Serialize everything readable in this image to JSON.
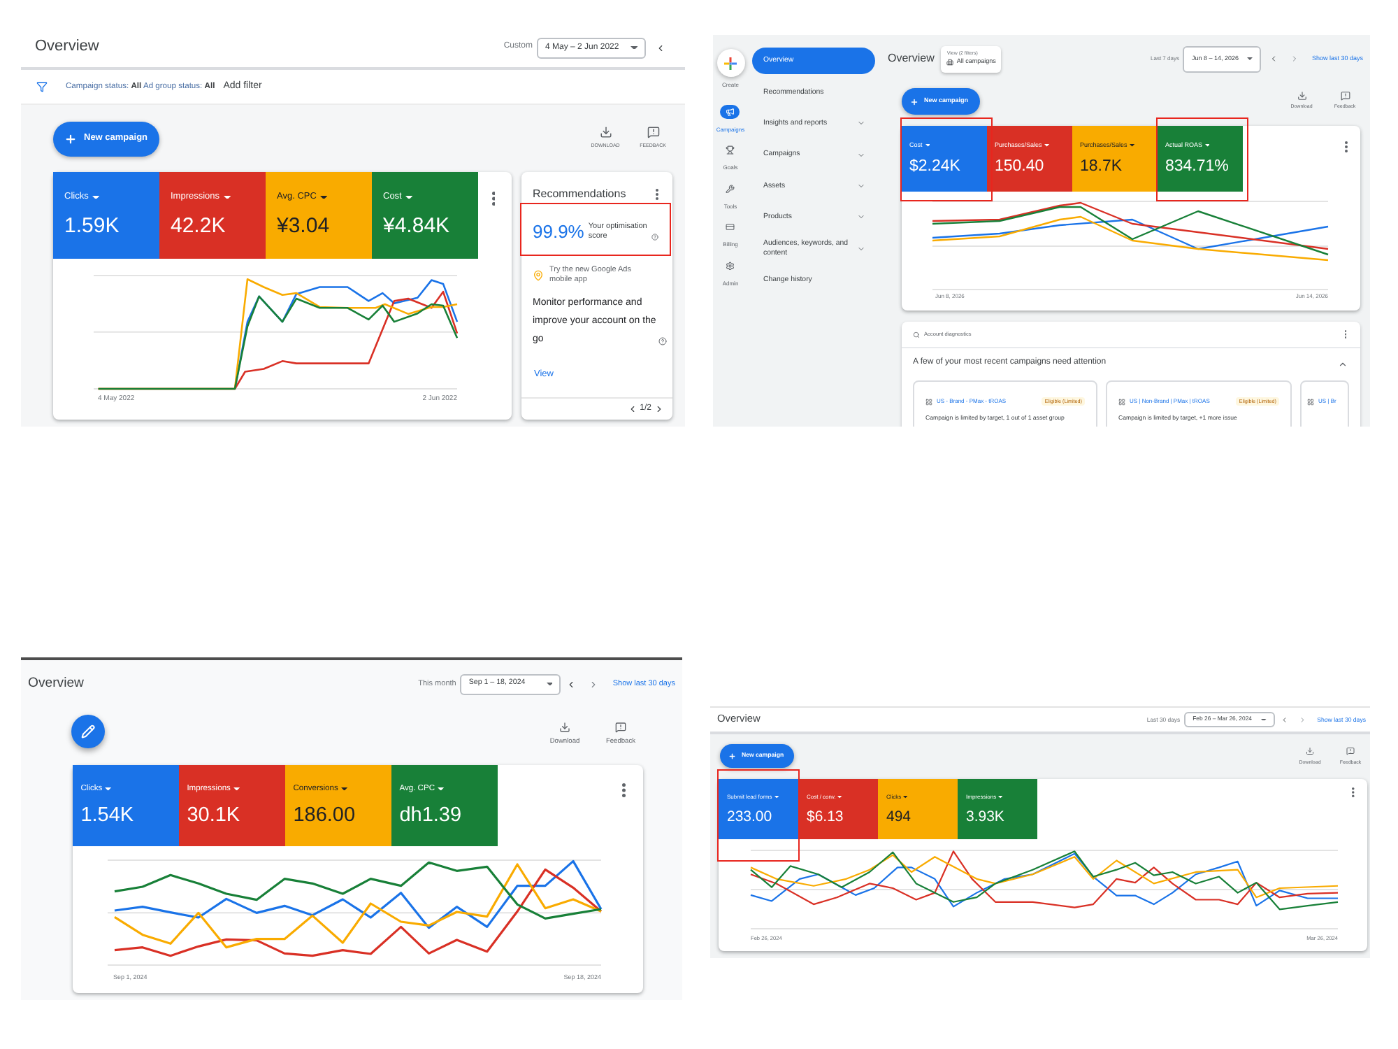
{
  "screenshots": [
    {
      "header": {
        "title": "Overview",
        "date_range_label": "Custom",
        "date_range": "4 May – 2 Jun 2022"
      },
      "filter_bar": {
        "filters": "Campaign status: **All** Ad group status: **All**",
        "add_filter": "Add filter"
      },
      "primary_action": {
        "kind": "new_campaign",
        "label": "New campaign"
      },
      "actions": [
        {
          "kind": "download",
          "label": "DOWNLOAD"
        },
        {
          "kind": "feedback",
          "label": "FEEDBACK"
        }
      ],
      "metrics": [
        {
          "label": "Clicks",
          "value": "1.59K",
          "color": "#1a73e8",
          "highlighted": false
        },
        {
          "label": "Impressions",
          "value": "42.2K",
          "color": "#d93025",
          "highlighted": false
        },
        {
          "label": "Avg. CPC",
          "value": "¥3.04",
          "color": "#f9ab00",
          "highlighted": false
        },
        {
          "label": "Cost",
          "value": "¥4.84K",
          "color": "#188038",
          "highlighted": false
        }
      ],
      "chart": {
        "start_date": "4 May 2022",
        "end_date": "2 Jun 2022"
      },
      "recommendations": {
        "title": "Recommendations",
        "score": "99.9%",
        "score_label": "Your optimisation score",
        "highlighted": true,
        "promo": "Try the new Google Ads mobile app",
        "message": "Monitor performance and improve your account on the go",
        "link": "View",
        "pager": "1/2"
      }
    },
    {
      "navigation_rail": [
        {
          "kind": "create",
          "label": "Create",
          "selected": false
        },
        {
          "kind": "campaigns",
          "label": "Campaigns",
          "selected": true
        },
        {
          "kind": "goals",
          "label": "Goals",
          "selected": false
        },
        {
          "kind": "tools",
          "label": "Tools",
          "selected": false
        },
        {
          "kind": "billing",
          "label": "Billing",
          "selected": false
        },
        {
          "kind": "admin",
          "label": "Admin",
          "selected": false
        }
      ],
      "sidebar": [
        {
          "label": "Overview",
          "selected": true,
          "expandable": false
        },
        {
          "label": "Recommendations",
          "selected": false,
          "expandable": false
        },
        {
          "label": "Insights and reports",
          "selected": false,
          "expandable": true
        },
        {
          "label": "Campaigns",
          "selected": false,
          "expandable": true
        },
        {
          "label": "Assets",
          "selected": false,
          "expandable": true
        },
        {
          "label": "Products",
          "selected": false,
          "expandable": true
        },
        {
          "label": "Audiences, keywords, and content",
          "selected": false,
          "expandable": true
        },
        {
          "label": "Change history",
          "selected": false,
          "expandable": false
        }
      ],
      "header": {
        "title": "Overview",
        "view_filter": {
          "label": "View (2 filters)",
          "value": "All campaigns"
        },
        "date_range_label": "Last 7 days",
        "date_range": "Jun 8 – 14, 2026",
        "show_last_30_days": "Show last 30 days"
      },
      "primary_action": {
        "kind": "new_campaign",
        "label": "New campaign"
      },
      "actions": [
        {
          "kind": "download",
          "label": "Download"
        },
        {
          "kind": "feedback",
          "label": "Feedback"
        }
      ],
      "metrics": [
        {
          "label": "Cost",
          "value": "$2.24K",
          "color": "#1a73e8",
          "highlighted": true
        },
        {
          "label": "Purchases/Sales",
          "value": "150.40",
          "color": "#d93025",
          "highlighted": false
        },
        {
          "label": "Purchases/Sales",
          "value": "18.7K",
          "color": "#f9ab00",
          "highlighted": false
        },
        {
          "label": "Actual ROAS",
          "value": "834.71%",
          "color": "#188038",
          "highlighted": true
        }
      ],
      "chart": {
        "start_date": "Jun 8, 2026",
        "end_date": "Jun 14, 2026"
      },
      "diagnostics": {
        "title": "Account diagnostics",
        "message": "A few of your most recent campaigns need attention",
        "expanded": true,
        "campaigns": [
          {
            "name": "US - Brand - PMax - tROAS",
            "status": "Eligible (Limited)",
            "issue": "Campaign is limited by target, 1 out of 1 asset group"
          },
          {
            "name": "US | Non-Brand | PMax | tROAS",
            "status": "Eligible (Limited)",
            "issue": "Campaign is limited by target, +1 more issue"
          },
          {
            "name": "US | Br"
          }
        ]
      }
    },
    {
      "header": {
        "title": "Overview",
        "date_range_label": "This month",
        "date_range": "Sep 1 – 18, 2024",
        "show_last_30_days": "Show last 30 days"
      },
      "primary_action": {
        "kind": "edit"
      },
      "actions": [
        {
          "kind": "download",
          "label": "Download"
        },
        {
          "kind": "feedback",
          "label": "Feedback"
        }
      ],
      "metrics": [
        {
          "label": "Clicks",
          "value": "1.54K",
          "color": "#1a73e8",
          "highlighted": false
        },
        {
          "label": "Impressions",
          "value": "30.1K",
          "color": "#d93025",
          "highlighted": false
        },
        {
          "label": "Conversions",
          "value": "186.00",
          "color": "#f9ab00",
          "highlighted": false
        },
        {
          "label": "Avg. CPC",
          "value": "dh1.39",
          "color": "#188038",
          "highlighted": false
        }
      ],
      "chart": {
        "start_date": "Sep 1, 2024",
        "end_date": "Sep 18, 2024"
      }
    },
    {
      "header": {
        "title": "Overview",
        "date_range_label": "Last 30 days",
        "date_range": "Feb 26 – Mar 26, 2024",
        "show_last_30_days": "Show last 30 days"
      },
      "primary_action": {
        "kind": "new_campaign",
        "label": "New campaign"
      },
      "actions": [
        {
          "kind": "download",
          "label": "Download"
        },
        {
          "kind": "feedback",
          "label": "Feedback"
        }
      ],
      "metrics": [
        {
          "label": "Submit lead forms",
          "value": "233.00",
          "color": "#1a73e8",
          "highlighted": true
        },
        {
          "label": "Cost / conv.",
          "value": "$6.13",
          "color": "#d93025",
          "highlighted": false
        },
        {
          "label": "Clicks",
          "value": "494",
          "color": "#f9ab00",
          "highlighted": false
        },
        {
          "label": "Impressions",
          "value": "3.93K",
          "color": "#188038",
          "highlighted": false
        }
      ],
      "chart": {
        "start_date": "Feb 26, 2024",
        "end_date": "Mar 26, 2024"
      }
    }
  ]
}
